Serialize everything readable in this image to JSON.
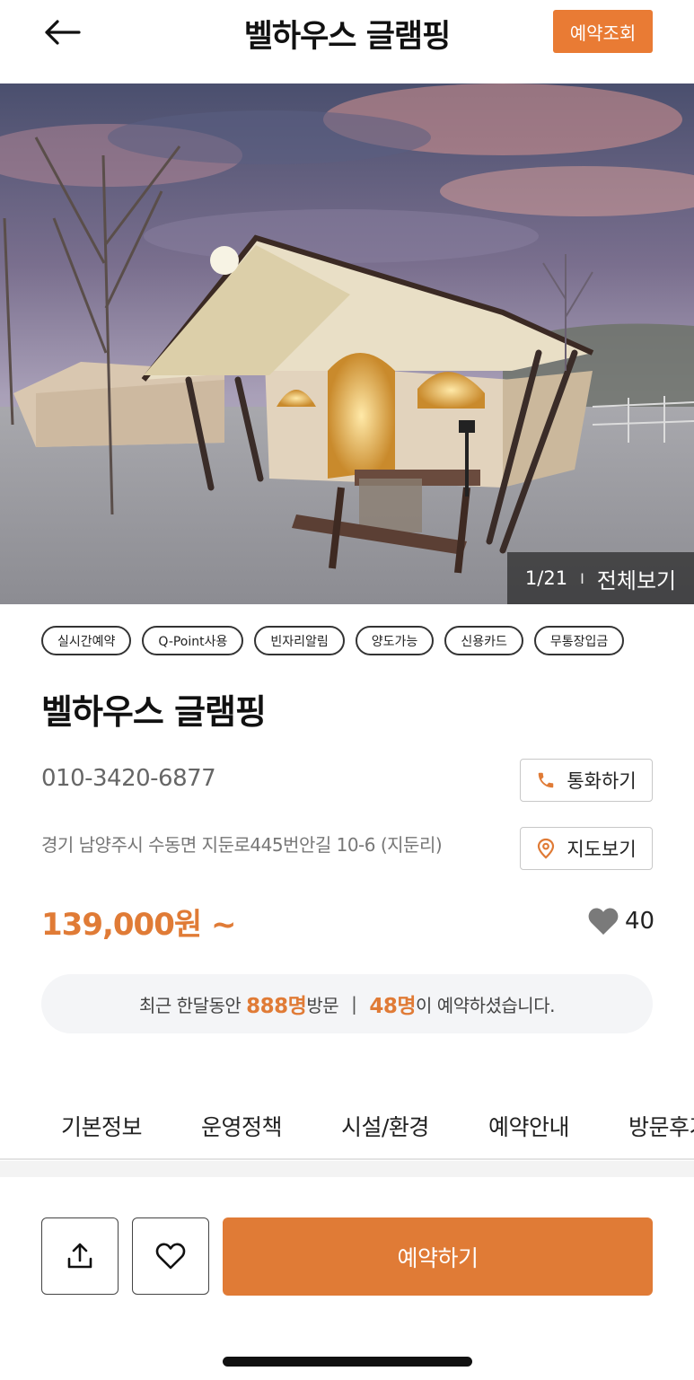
{
  "header": {
    "title": "벨하우스 글램핑",
    "reserve_lookup_label": "예약조회",
    "back_icon": "arrow-left-icon"
  },
  "gallery": {
    "current": "1/21",
    "separator": "I",
    "view_all_label": "전체보기"
  },
  "tags": [
    "실시간예약",
    "Q-Point사용",
    "빈자리알림",
    "양도가능",
    "신용카드",
    "무통장입금"
  ],
  "place": {
    "name": "벨하우스 글램핑",
    "phone": "010-3420-6877",
    "address": "경기 남양주시 수동면 지둔로445번안길 10-6 (지둔리)",
    "call_label": "통화하기",
    "map_label": "지도보기",
    "price": "139,000원 ~",
    "likes": "40"
  },
  "visit_banner": {
    "prefix": "최근 한달동안",
    "visitors": "888명",
    "visit_suffix": "방문",
    "separator": "|",
    "bookers": "48명",
    "book_suffix": "이 예약하셨습니다."
  },
  "tabs": [
    "기본정보",
    "운영정책",
    "시설/환경",
    "예약안내",
    "방문후기"
  ],
  "bottom": {
    "book_label": "예약하기",
    "share_icon": "share-icon",
    "favorite_icon": "heart-outline-icon"
  },
  "colors": {
    "accent": "#e07b36",
    "header_button": "#e97b34"
  }
}
